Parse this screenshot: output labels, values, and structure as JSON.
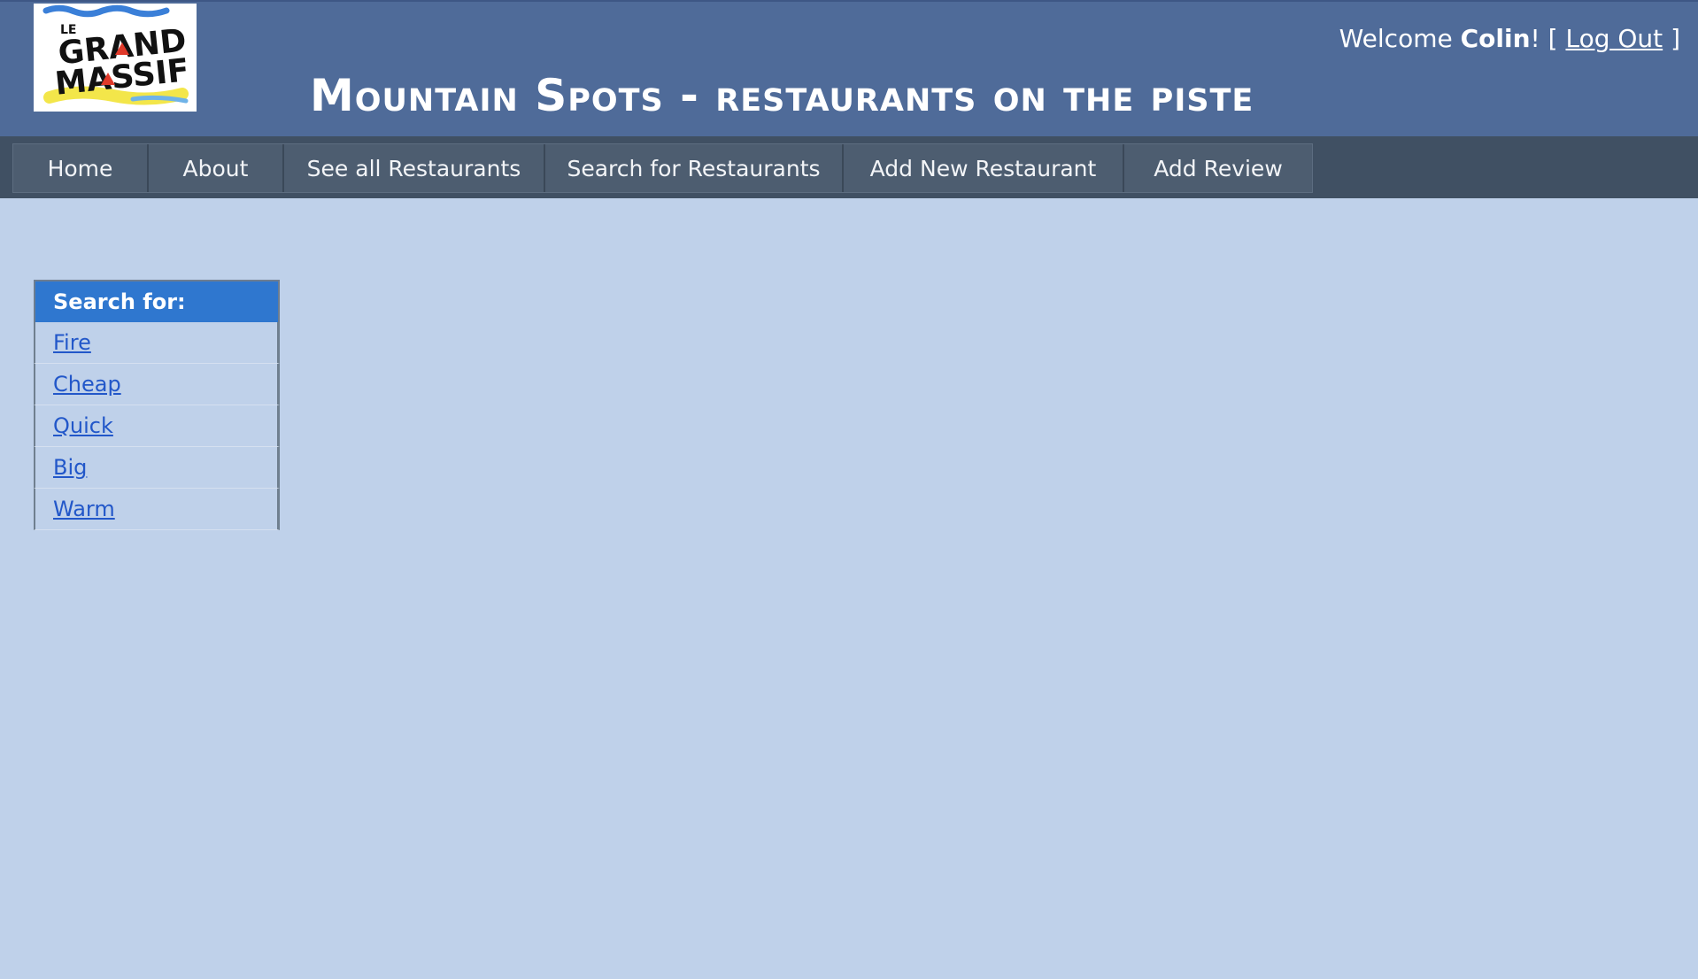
{
  "header": {
    "logo_text": "Le Grand Massif",
    "site_title": "Mountain Spots  - restaurants on the piste",
    "welcome_prefix": "Welcome ",
    "user_name": "Colin",
    "welcome_suffix": "! [ ",
    "logout_label": "Log Out",
    "close_bracket": " ]",
    "colors": {
      "header_bg": "#4f6b99",
      "navbar_bg": "#405063",
      "page_bg": "#bfd1ea"
    }
  },
  "nav": {
    "items": [
      {
        "label": "Home"
      },
      {
        "label": "About"
      },
      {
        "label": "See all Restaurants"
      },
      {
        "label": "Search for Restaurants"
      },
      {
        "label": "Add New Restaurant"
      },
      {
        "label": "Add Review"
      }
    ]
  },
  "search": {
    "heading": "Search for:",
    "heading_color": "#2f77cf",
    "link_color": "#2257c9",
    "options": [
      {
        "label": "Fire"
      },
      {
        "label": "Cheap"
      },
      {
        "label": "Quick"
      },
      {
        "label": "Big"
      },
      {
        "label": "Warm"
      }
    ]
  }
}
